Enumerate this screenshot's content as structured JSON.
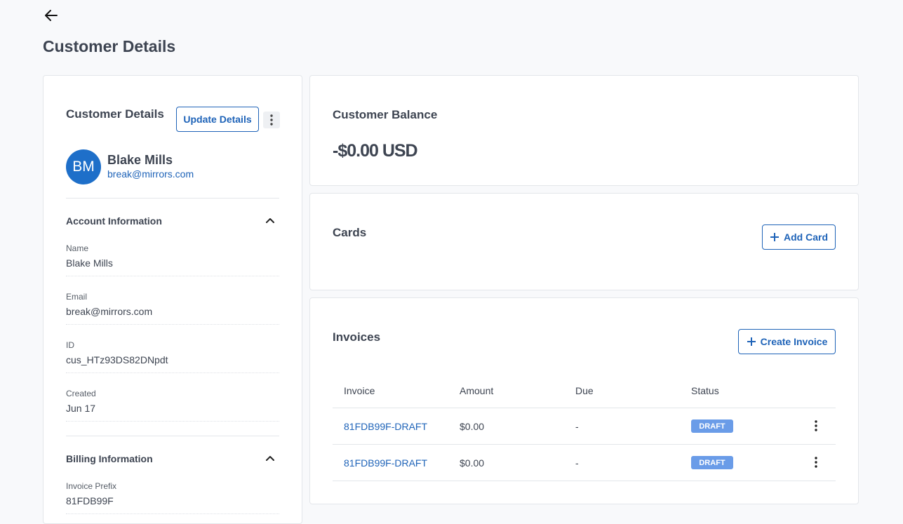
{
  "page": {
    "title": "Customer Details"
  },
  "customer_panel": {
    "title": "Customer Details",
    "update_button": "Update Details",
    "avatar_initials": "BM",
    "name": "Blake Mills",
    "email": "break@mirrors.com",
    "account_section": {
      "heading": "Account Information",
      "fields": [
        {
          "label": "Name",
          "value": "Blake Mills"
        },
        {
          "label": "Email",
          "value": "break@mirrors.com"
        },
        {
          "label": "ID",
          "value": "cus_HTz93DS82DNpdt"
        },
        {
          "label": "Created",
          "value": "Jun 17"
        }
      ]
    },
    "billing_section": {
      "heading": "Billing Information",
      "fields": [
        {
          "label": "Invoice Prefix",
          "value": "81FDB99F"
        }
      ]
    }
  },
  "balance": {
    "title": "Customer Balance",
    "amount": "-$0.00 USD"
  },
  "cards": {
    "title": "Cards",
    "add_button": "Add Card"
  },
  "invoices": {
    "title": "Invoices",
    "create_button": "Create Invoice",
    "columns": [
      "Invoice",
      "Amount",
      "Due",
      "Status"
    ],
    "rows": [
      {
        "invoice": "81FDB99F-DRAFT",
        "amount": "$0.00",
        "due": "-",
        "status": "DRAFT"
      },
      {
        "invoice": "81FDB99F-DRAFT",
        "amount": "$0.00",
        "due": "-",
        "status": "DRAFT"
      }
    ]
  },
  "colors": {
    "accent": "#1e63b8",
    "avatar": "#1e6fc9",
    "draft_badge": "#6a9ce8",
    "background": "#f8f9fb"
  },
  "icons": [
    "arrow-left-icon",
    "kebab-menu-icon",
    "chevron-up-icon",
    "plus-icon"
  ]
}
